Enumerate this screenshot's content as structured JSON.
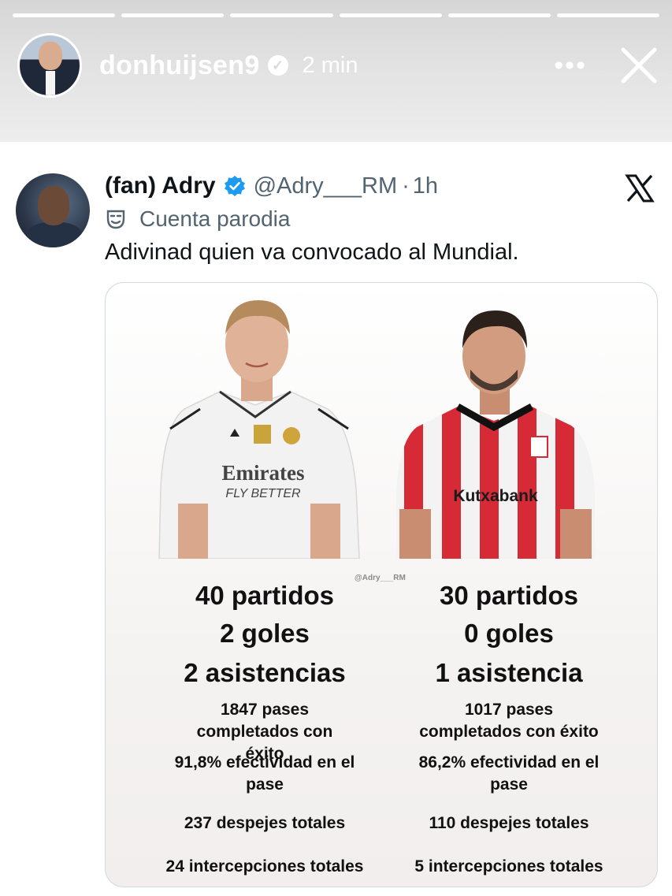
{
  "story": {
    "username": "donhuijsen9",
    "time": "2 min",
    "more_icon": "more-horizontal-icon",
    "close_icon": "close-icon"
  },
  "tweet": {
    "display_name": "(fan) Adry",
    "handle": "@Adry___RM",
    "separator": "·",
    "time": "1h",
    "parody_label": "Cuenta parodia",
    "text": "Adivinad quien va convocado al Mundial.",
    "verified_color": "#1d9bf0"
  },
  "graphic": {
    "watermark": "@Adry___RM",
    "left_player": {
      "jersey_sponsor": "Emirates",
      "jersey_slogan": "FLY BETTER",
      "stats_big": [
        "40 partidos",
        "2 goles",
        "2 asistencias"
      ],
      "stats_small": [
        "1847 pases completados con éxito",
        "91,8% efectividad en el pase",
        "237 despejes totales",
        "24 intercepciones totales"
      ]
    },
    "right_player": {
      "jersey_sponsor": "Kutxabank",
      "stats_big": [
        "30 partidos",
        "0 goles",
        "1 asistencia"
      ],
      "stats_small": [
        "1017 pases completados con éxito",
        "86,2% efectividad en el pase",
        "110 despejes totales",
        "5 intercepciones totales"
      ]
    }
  }
}
